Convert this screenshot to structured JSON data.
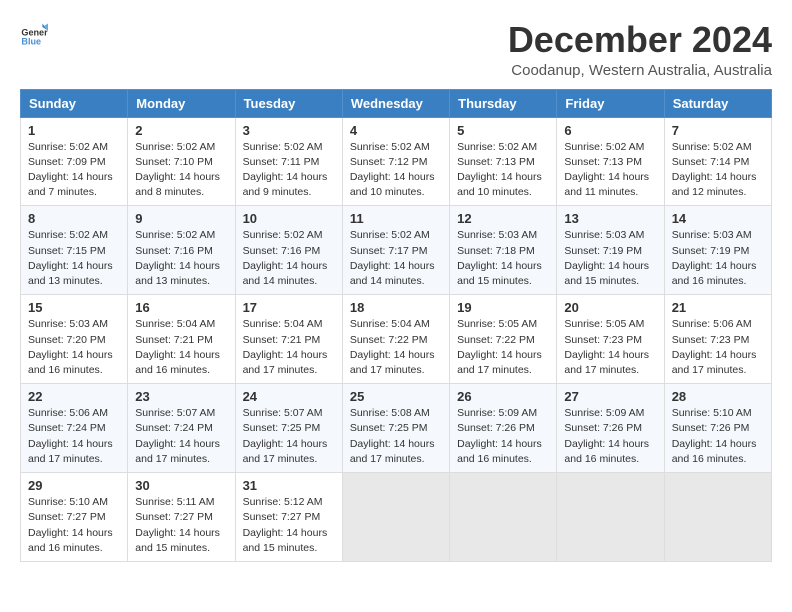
{
  "logo": {
    "text_general": "General",
    "text_blue": "Blue"
  },
  "header": {
    "month_title": "December 2024",
    "location": "Coodanup, Western Australia, Australia"
  },
  "weekdays": [
    "Sunday",
    "Monday",
    "Tuesday",
    "Wednesday",
    "Thursday",
    "Friday",
    "Saturday"
  ],
  "weeks": [
    [
      {
        "day": "1",
        "sunrise": "Sunrise: 5:02 AM",
        "sunset": "Sunset: 7:09 PM",
        "daylight": "Daylight: 14 hours and 7 minutes."
      },
      {
        "day": "2",
        "sunrise": "Sunrise: 5:02 AM",
        "sunset": "Sunset: 7:10 PM",
        "daylight": "Daylight: 14 hours and 8 minutes."
      },
      {
        "day": "3",
        "sunrise": "Sunrise: 5:02 AM",
        "sunset": "Sunset: 7:11 PM",
        "daylight": "Daylight: 14 hours and 9 minutes."
      },
      {
        "day": "4",
        "sunrise": "Sunrise: 5:02 AM",
        "sunset": "Sunset: 7:12 PM",
        "daylight": "Daylight: 14 hours and 10 minutes."
      },
      {
        "day": "5",
        "sunrise": "Sunrise: 5:02 AM",
        "sunset": "Sunset: 7:13 PM",
        "daylight": "Daylight: 14 hours and 10 minutes."
      },
      {
        "day": "6",
        "sunrise": "Sunrise: 5:02 AM",
        "sunset": "Sunset: 7:13 PM",
        "daylight": "Daylight: 14 hours and 11 minutes."
      },
      {
        "day": "7",
        "sunrise": "Sunrise: 5:02 AM",
        "sunset": "Sunset: 7:14 PM",
        "daylight": "Daylight: 14 hours and 12 minutes."
      }
    ],
    [
      {
        "day": "8",
        "sunrise": "Sunrise: 5:02 AM",
        "sunset": "Sunset: 7:15 PM",
        "daylight": "Daylight: 14 hours and 13 minutes."
      },
      {
        "day": "9",
        "sunrise": "Sunrise: 5:02 AM",
        "sunset": "Sunset: 7:16 PM",
        "daylight": "Daylight: 14 hours and 13 minutes."
      },
      {
        "day": "10",
        "sunrise": "Sunrise: 5:02 AM",
        "sunset": "Sunset: 7:16 PM",
        "daylight": "Daylight: 14 hours and 14 minutes."
      },
      {
        "day": "11",
        "sunrise": "Sunrise: 5:02 AM",
        "sunset": "Sunset: 7:17 PM",
        "daylight": "Daylight: 14 hours and 14 minutes."
      },
      {
        "day": "12",
        "sunrise": "Sunrise: 5:03 AM",
        "sunset": "Sunset: 7:18 PM",
        "daylight": "Daylight: 14 hours and 15 minutes."
      },
      {
        "day": "13",
        "sunrise": "Sunrise: 5:03 AM",
        "sunset": "Sunset: 7:19 PM",
        "daylight": "Daylight: 14 hours and 15 minutes."
      },
      {
        "day": "14",
        "sunrise": "Sunrise: 5:03 AM",
        "sunset": "Sunset: 7:19 PM",
        "daylight": "Daylight: 14 hours and 16 minutes."
      }
    ],
    [
      {
        "day": "15",
        "sunrise": "Sunrise: 5:03 AM",
        "sunset": "Sunset: 7:20 PM",
        "daylight": "Daylight: 14 hours and 16 minutes."
      },
      {
        "day": "16",
        "sunrise": "Sunrise: 5:04 AM",
        "sunset": "Sunset: 7:21 PM",
        "daylight": "Daylight: 14 hours and 16 minutes."
      },
      {
        "day": "17",
        "sunrise": "Sunrise: 5:04 AM",
        "sunset": "Sunset: 7:21 PM",
        "daylight": "Daylight: 14 hours and 17 minutes."
      },
      {
        "day": "18",
        "sunrise": "Sunrise: 5:04 AM",
        "sunset": "Sunset: 7:22 PM",
        "daylight": "Daylight: 14 hours and 17 minutes."
      },
      {
        "day": "19",
        "sunrise": "Sunrise: 5:05 AM",
        "sunset": "Sunset: 7:22 PM",
        "daylight": "Daylight: 14 hours and 17 minutes."
      },
      {
        "day": "20",
        "sunrise": "Sunrise: 5:05 AM",
        "sunset": "Sunset: 7:23 PM",
        "daylight": "Daylight: 14 hours and 17 minutes."
      },
      {
        "day": "21",
        "sunrise": "Sunrise: 5:06 AM",
        "sunset": "Sunset: 7:23 PM",
        "daylight": "Daylight: 14 hours and 17 minutes."
      }
    ],
    [
      {
        "day": "22",
        "sunrise": "Sunrise: 5:06 AM",
        "sunset": "Sunset: 7:24 PM",
        "daylight": "Daylight: 14 hours and 17 minutes."
      },
      {
        "day": "23",
        "sunrise": "Sunrise: 5:07 AM",
        "sunset": "Sunset: 7:24 PM",
        "daylight": "Daylight: 14 hours and 17 minutes."
      },
      {
        "day": "24",
        "sunrise": "Sunrise: 5:07 AM",
        "sunset": "Sunset: 7:25 PM",
        "daylight": "Daylight: 14 hours and 17 minutes."
      },
      {
        "day": "25",
        "sunrise": "Sunrise: 5:08 AM",
        "sunset": "Sunset: 7:25 PM",
        "daylight": "Daylight: 14 hours and 17 minutes."
      },
      {
        "day": "26",
        "sunrise": "Sunrise: 5:09 AM",
        "sunset": "Sunset: 7:26 PM",
        "daylight": "Daylight: 14 hours and 16 minutes."
      },
      {
        "day": "27",
        "sunrise": "Sunrise: 5:09 AM",
        "sunset": "Sunset: 7:26 PM",
        "daylight": "Daylight: 14 hours and 16 minutes."
      },
      {
        "day": "28",
        "sunrise": "Sunrise: 5:10 AM",
        "sunset": "Sunset: 7:26 PM",
        "daylight": "Daylight: 14 hours and 16 minutes."
      }
    ],
    [
      {
        "day": "29",
        "sunrise": "Sunrise: 5:10 AM",
        "sunset": "Sunset: 7:27 PM",
        "daylight": "Daylight: 14 hours and 16 minutes."
      },
      {
        "day": "30",
        "sunrise": "Sunrise: 5:11 AM",
        "sunset": "Sunset: 7:27 PM",
        "daylight": "Daylight: 14 hours and 15 minutes."
      },
      {
        "day": "31",
        "sunrise": "Sunrise: 5:12 AM",
        "sunset": "Sunset: 7:27 PM",
        "daylight": "Daylight: 14 hours and 15 minutes."
      },
      null,
      null,
      null,
      null
    ]
  ]
}
